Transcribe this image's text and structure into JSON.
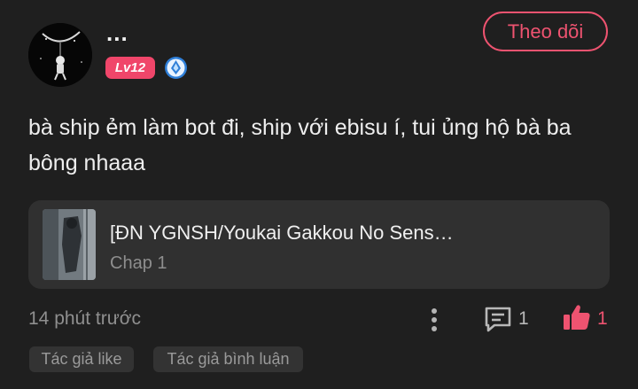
{
  "author": {
    "name": "...",
    "level": "Lv12",
    "follow_label": "Theo dõi"
  },
  "comment": {
    "text": "bà ship ẻm làm bot đi, ship với ebisu í, tui ủng hộ bà ba bông nhaaa"
  },
  "story": {
    "title": "[ĐN YGNSH/Youkai Gakkou No Sens…",
    "chapter": "Chap 1"
  },
  "meta": {
    "time": "14 phút trước",
    "comment_count": "1",
    "like_count": "1"
  },
  "tags": [
    "Tác giả like",
    "Tác giả bình luận"
  ],
  "colors": {
    "background": "#1f1f1f",
    "accent": "#ee5370",
    "level_badge": "#f0466a",
    "card": "#303030",
    "muted_text": "#8f8f8f"
  },
  "icons": [
    "avatar-astronaut",
    "verified-badge-icon",
    "more-vertical-icon",
    "comment-icon",
    "thumbs-up-icon"
  ]
}
